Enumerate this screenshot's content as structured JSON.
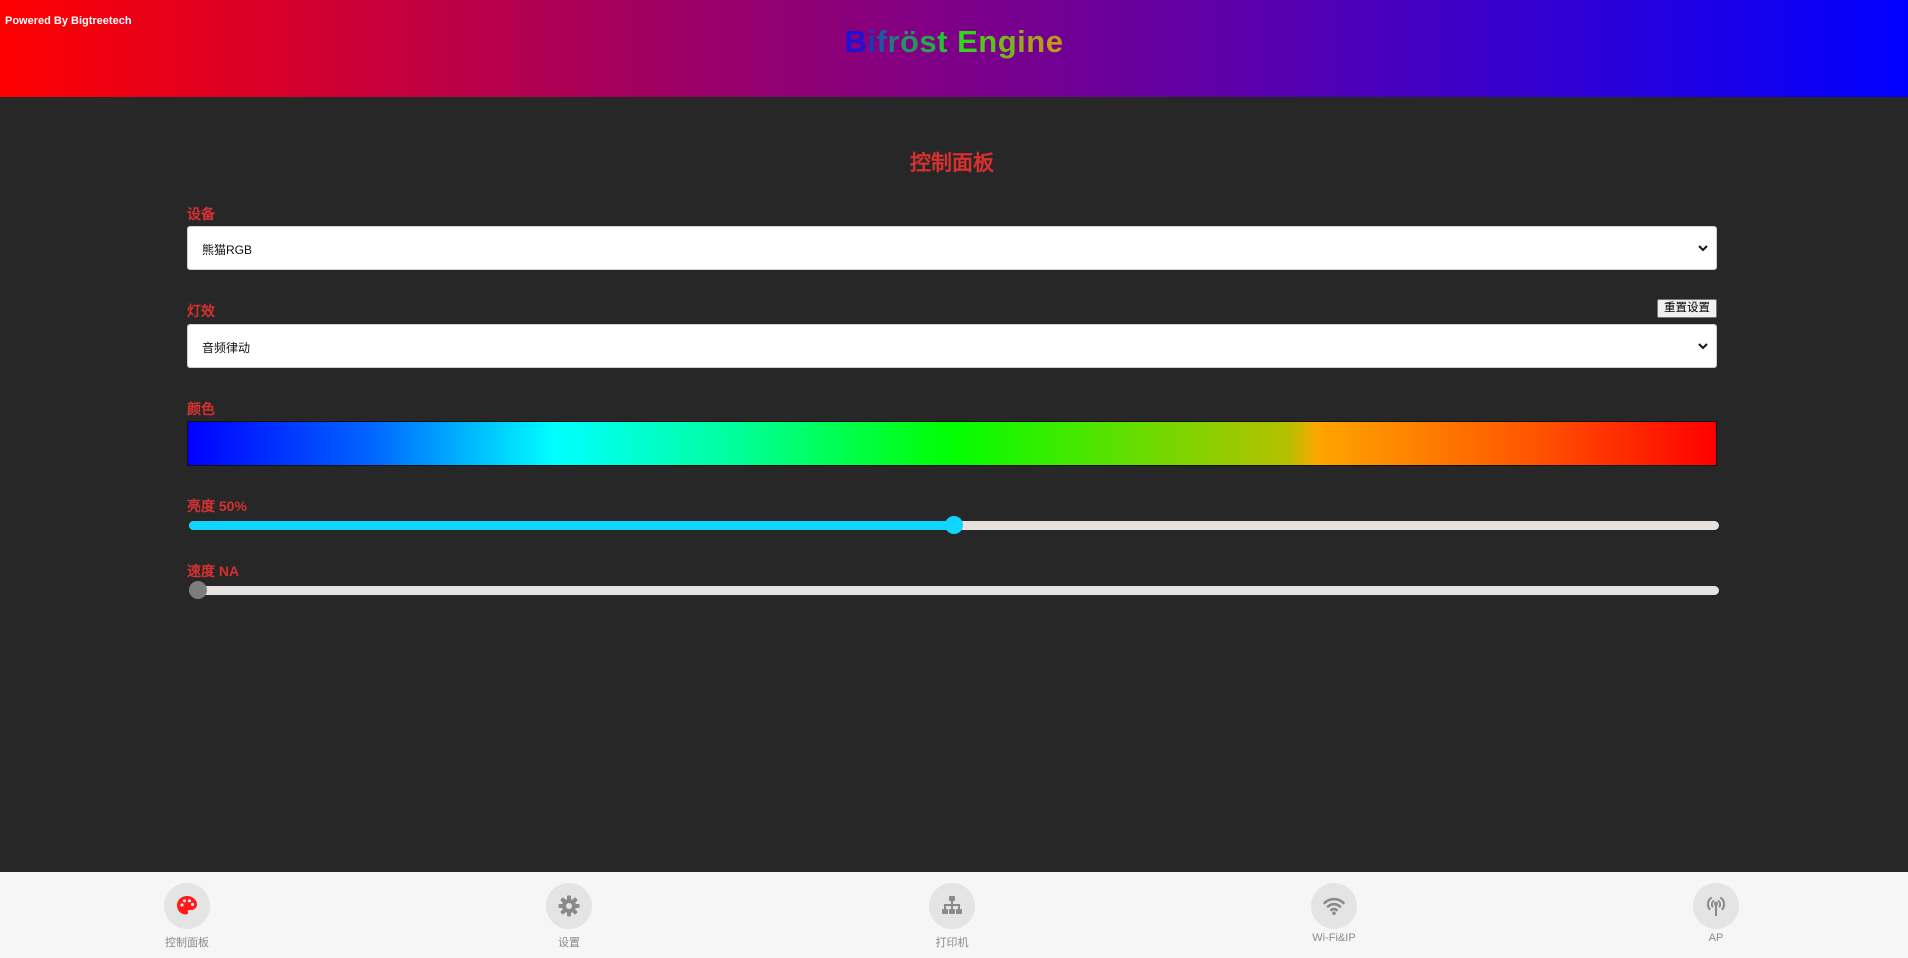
{
  "header": {
    "powered_by": "Powered By Bigtreetech",
    "brand_letters": [
      {
        "ch": "B",
        "color": "#1b12d9"
      },
      {
        "ch": "i",
        "color": "#1e38b8"
      },
      {
        "ch": "f",
        "color": "#1f57a0"
      },
      {
        "ch": "r",
        "color": "#227a80"
      },
      {
        "ch": "ö",
        "color": "#249560"
      },
      {
        "ch": "s",
        "color": "#25aa4a"
      },
      {
        "ch": "t",
        "color": "#27c035"
      },
      {
        "ch": " ",
        "color": "#27c035"
      },
      {
        "ch": "E",
        "color": "#33d41d"
      },
      {
        "ch": "n",
        "color": "#59c21c"
      },
      {
        "ch": "g",
        "color": "#79b51a"
      },
      {
        "ch": "i",
        "color": "#92ab19"
      },
      {
        "ch": "n",
        "color": "#aaa118"
      },
      {
        "ch": "e",
        "color": "#c19a16"
      }
    ]
  },
  "main": {
    "title": "控制面板",
    "device": {
      "label": "设备",
      "value": "熊猫RGB"
    },
    "effect": {
      "label": "灯效",
      "value": "音频律动",
      "reset_label": "重置设置"
    },
    "color": {
      "label": "颜色"
    },
    "brightness": {
      "label": "亮度 50%",
      "value": 0.5,
      "fill_color": "#0fd6ff"
    },
    "speed": {
      "label": "速度 NA",
      "value": 0.0,
      "thumb_color": "#7d7d7d"
    }
  },
  "footer": {
    "items": [
      {
        "label": "控制面板",
        "icon": "palette-icon",
        "active": true,
        "icon_color": "#ff1a1a"
      },
      {
        "label": "设置",
        "icon": "gear-icon",
        "active": false,
        "icon_color": "#8a8a8a"
      },
      {
        "label": "打印机",
        "icon": "sitemap-icon",
        "active": false,
        "icon_color": "#8a8a8a"
      },
      {
        "label": "Wi-Fi&IP",
        "icon": "wifi-icon",
        "active": false,
        "icon_color": "#8a8a8a"
      },
      {
        "label": "AP",
        "icon": "broadcast-tower-icon",
        "active": false,
        "icon_color": "#8a8a8a"
      }
    ]
  }
}
